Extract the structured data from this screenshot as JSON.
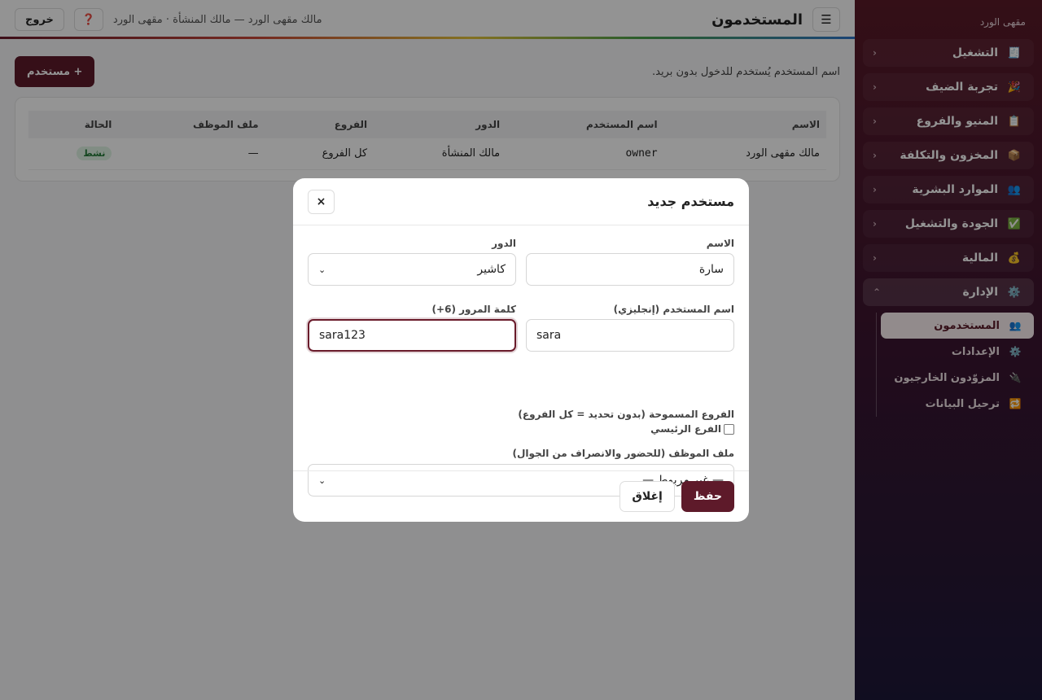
{
  "sidebar": {
    "brand": "مقهى الورد",
    "groups": [
      {
        "label": "التشغيل",
        "icon": "🧾"
      },
      {
        "label": "تجربة الضيف",
        "icon": "🎉"
      },
      {
        "label": "المنيو والفروع",
        "icon": "📋"
      },
      {
        "label": "المخزون والتكلفة",
        "icon": "📦"
      },
      {
        "label": "الموارد البشرية",
        "icon": "👥"
      },
      {
        "label": "الجودة والتشغيل",
        "icon": "✅"
      },
      {
        "label": "المالية",
        "icon": "💰"
      },
      {
        "label": "الإدارة",
        "icon": "⚙️"
      }
    ],
    "chev_closed": "‹",
    "chev_open": "⌃",
    "subitems": [
      {
        "label": "المستخدمون",
        "icon": "👥"
      },
      {
        "label": "الإعدادات",
        "icon": "⚙️"
      },
      {
        "label": "المزوّدون الخارجيون",
        "icon": "🔌"
      },
      {
        "label": "ترحيل البيانات",
        "icon": "🔁"
      }
    ]
  },
  "topbar": {
    "menu_icon": "☰",
    "title": "المستخدمون",
    "meta": "مالك مقهى الورد — مالك المنشأة · مقهى الورد",
    "help_icon": "❓",
    "logout": "خروج"
  },
  "toolbar": {
    "hint": "اسم المستخدم يُستخدم للدخول بدون بريد.",
    "add_button": "+ مستخدم"
  },
  "table": {
    "headers": [
      "الاسم",
      "اسم المستخدم",
      "الدور",
      "الفروع",
      "ملف الموظف",
      "الحالة"
    ],
    "rows": [
      {
        "name": "مالك مقهى الورد",
        "username": "owner",
        "role": "مالك المنشأة",
        "branches": "كل الفروع",
        "employee": "—",
        "status": "نشط"
      }
    ]
  },
  "modal": {
    "title": "مستخدم جديد",
    "close_icon": "×",
    "name_label": "الاسم",
    "name_value": "سارة",
    "role_label": "الدور",
    "role_value": "كاشير",
    "username_label": "اسم المستخدم (إنجليزي)",
    "username_value": "sara",
    "password_label": "كلمة المرور (6+)",
    "password_value": "sara123",
    "branches_label": "الفروع المسموحة (بدون تحديد = كل الفروع)",
    "branch_option": "الفرع الرئيسي",
    "employee_label": "ملف الموظف (للحضور والانصراف من الجوال)",
    "employee_value": "— غير مربوط —",
    "save": "حفظ",
    "close": "إغلاق"
  },
  "colors": {
    "brand": "#5e1a2a",
    "active_badge_bg": "#dff3e3",
    "active_badge_text": "#237a37"
  }
}
